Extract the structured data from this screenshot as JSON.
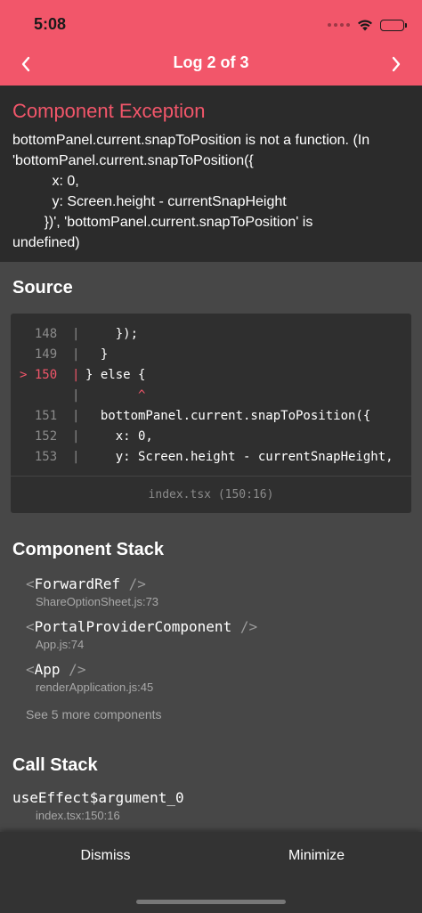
{
  "status_bar": {
    "time": "5:08",
    "icons": [
      "signal-icon",
      "wifi-icon",
      "battery-icon"
    ]
  },
  "nav": {
    "title": "Log 2 of 3",
    "prev_icon": "chevron-left-icon",
    "next_icon": "chevron-right-icon"
  },
  "exception": {
    "title": "Component Exception",
    "message": "bottomPanel.current.snapToPosition is not a function. (In\n'bottomPanel.current.snapToPosition({\n          x: 0,\n          y: Screen.height - currentSnapHeight\n        })', 'bottomPanel.current.snapToPosition' is\nundefined)"
  },
  "source": {
    "title": "Source",
    "lines": [
      {
        "gutter": "  148  |",
        "code": "    });"
      },
      {
        "gutter": "  149  |",
        "code": "  }"
      },
      {
        "gutter": "> 150  |",
        "code": "} else {"
      },
      {
        "gutter": "       |",
        "code": "       ^"
      },
      {
        "gutter": "  151  |",
        "code": "  bottomPanel.current.snapToPosition({"
      },
      {
        "gutter": "  152  |",
        "code": "    x: 0,"
      },
      {
        "gutter": "  153  |",
        "code": "    y: Screen.height - currentSnapHeight,"
      }
    ],
    "location": "index.tsx (150:16)"
  },
  "component_stack": {
    "title": "Component Stack",
    "items": [
      {
        "open": "<",
        "name": "ForwardRef",
        "close": " />",
        "file": "ShareOptionSheet.js:73"
      },
      {
        "open": "<",
        "name": "PortalProviderComponent",
        "close": " />",
        "file": "App.js:74"
      },
      {
        "open": "<",
        "name": "App",
        "close": " />",
        "file": "renderApplication.js:45"
      }
    ],
    "see_more": "See 5 more components"
  },
  "call_stack": {
    "title": "Call Stack",
    "items": [
      {
        "name": "useEffect$argument_0",
        "file": "index.tsx:150:16"
      }
    ]
  },
  "actions": {
    "dismiss": "Dismiss",
    "minimize": "Minimize"
  },
  "colors": {
    "accent": "#f2566a",
    "background": "#474747",
    "panel": "#2b2b2b"
  }
}
